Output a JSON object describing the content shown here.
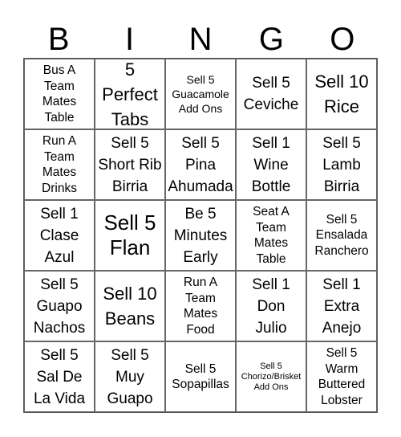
{
  "header": [
    "B",
    "I",
    "N",
    "G",
    "O"
  ],
  "grid": [
    [
      {
        "text": "Bus A\nTeam\nMates\nTable",
        "size": "md"
      },
      {
        "text": "5\nPerfect\nTabs",
        "size": "xl"
      },
      {
        "text": "Sell 5\nGuacamole\nAdd Ons",
        "size": "sm"
      },
      {
        "text": "Sell 5\nCeviche",
        "size": "lg"
      },
      {
        "text": "Sell 10\nRice",
        "size": "xl"
      }
    ],
    [
      {
        "text": "Run A\nTeam\nMates\nDrinks",
        "size": "md"
      },
      {
        "text": "Sell 5\nShort Rib\nBirria",
        "size": "lg"
      },
      {
        "text": "Sell 5\nPina\nAhumada",
        "size": "lg"
      },
      {
        "text": "Sell 1\nWine\nBottle",
        "size": "lg"
      },
      {
        "text": "Sell 5\nLamb\nBirria",
        "size": "lg"
      }
    ],
    [
      {
        "text": "Sell 1\nClase\nAzul",
        "size": "lg"
      },
      {
        "text": "Sell 5\nFlan",
        "size": "xxl"
      },
      {
        "text": "Be 5\nMinutes\nEarly",
        "size": "lg"
      },
      {
        "text": "Seat A\nTeam\nMates\nTable",
        "size": "md"
      },
      {
        "text": "Sell 5\nEnsalada\nRanchero",
        "size": "md"
      }
    ],
    [
      {
        "text": "Sell 5\nGuapo\nNachos",
        "size": "lg"
      },
      {
        "text": "Sell 10\nBeans",
        "size": "xl"
      },
      {
        "text": "Run A\nTeam\nMates\nFood",
        "size": "md"
      },
      {
        "text": "Sell 1\nDon\nJulio",
        "size": "lg"
      },
      {
        "text": "Sell 1\nExtra\nAnejo",
        "size": "lg"
      }
    ],
    [
      {
        "text": "Sell 5\nSal De\nLa Vida",
        "size": "lg"
      },
      {
        "text": "Sell 5\nMuy\nGuapo",
        "size": "lg"
      },
      {
        "text": "Sell 5\nSopapillas",
        "size": "md"
      },
      {
        "text": "Sell 5\nChorizo/Brisket\nAdd Ons",
        "size": "xs"
      },
      {
        "text": "Sell 5\nWarm\nButtered\nLobster",
        "size": "md"
      }
    ]
  ]
}
